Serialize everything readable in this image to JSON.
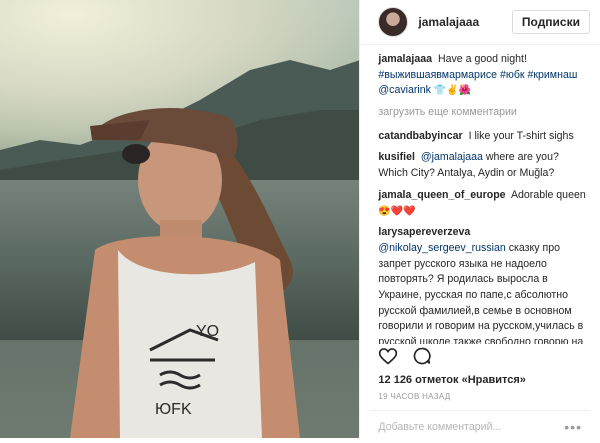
{
  "post": {
    "username": "jamalajaaa",
    "follow_label": "Подписки",
    "caption": {
      "username": "jamalajaaa",
      "text": "Have a good night!",
      "hashtags": "#выжившаявмармарисе #юбк #кримнаш",
      "mention": "@caviarink",
      "emoji": "👕✌️🌺"
    },
    "load_more": "загрузить еще комментарии",
    "comments": [
      {
        "user": "catandbabyincar",
        "text": "I like your T-shirt sighs"
      },
      {
        "user": "kusifiel",
        "mention": "@jamalajaaa",
        "text": "where are you? Which City? Antalya, Aydin or Muğla?"
      },
      {
        "user": "jamala_queen_of_europe",
        "text": "Adorable queen",
        "emoji": "😍❤️❤️"
      },
      {
        "user": "larysapereverzeva",
        "mention": "@nikolay_sergeev_russian",
        "text": "сказку про запрет русского языка не надоело повторять? Я родилась выросла в Украине, русская по папе,с абсолютно русской фамилией,в семье в основном говорили и говорим на русском,училась в русской школе,также свободно говорю на украинском.Никто и никогда не запрещал мне в Украине"
      }
    ],
    "likes": "12 126 отметок «Нравится»",
    "time_ago": "19 ЧАСОВ НАЗАД",
    "add_comment_placeholder": "Добавьте комментарий...",
    "icons": {
      "like": "heart-icon",
      "comment": "comment-icon",
      "more": "more-options-icon"
    },
    "photo_print": {
      "top": "YO",
      "bottom": "ЮFK"
    }
  }
}
